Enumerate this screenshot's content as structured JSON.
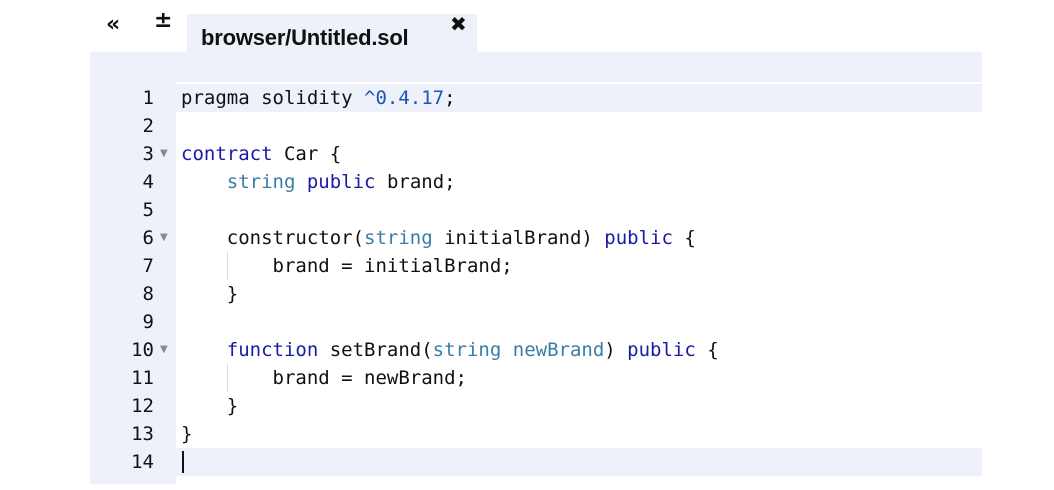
{
  "toolbar": {
    "collapse_glyph": "«",
    "plusminus_glyph": "±",
    "close_glyph": "✖"
  },
  "tab": {
    "label": "browser/Untitled.sol"
  },
  "editor": {
    "lines": [
      {
        "no": "1",
        "fold": false,
        "parts": [
          [
            "",
            "pragma solidity "
          ],
          [
            "num",
            "^0.4.17"
          ],
          [
            "",
            ";"
          ]
        ]
      },
      {
        "no": "2",
        "fold": false,
        "parts": []
      },
      {
        "no": "3",
        "fold": true,
        "parts": [
          [
            "kw",
            "contract"
          ],
          [
            "",
            " Car {"
          ]
        ]
      },
      {
        "no": "4",
        "fold": false,
        "parts": [
          [
            "",
            "    "
          ],
          [
            "ty",
            "string"
          ],
          [
            "",
            " "
          ],
          [
            "kw",
            "public"
          ],
          [
            "",
            " brand;"
          ]
        ]
      },
      {
        "no": "5",
        "fold": false,
        "parts": []
      },
      {
        "no": "6",
        "fold": true,
        "parts": [
          [
            "",
            "    constructor("
          ],
          [
            "ty",
            "string"
          ],
          [
            "",
            " initialBrand) "
          ],
          [
            "kw",
            "public"
          ],
          [
            "",
            " {"
          ]
        ]
      },
      {
        "no": "7",
        "fold": false,
        "parts": [
          [
            "",
            "        brand = initialBrand;"
          ]
        ]
      },
      {
        "no": "8",
        "fold": false,
        "parts": [
          [
            "",
            "    }"
          ]
        ]
      },
      {
        "no": "9",
        "fold": false,
        "parts": []
      },
      {
        "no": "10",
        "fold": true,
        "parts": [
          [
            "",
            "    "
          ],
          [
            "kw",
            "function"
          ],
          [
            "",
            " setBrand("
          ],
          [
            "ty",
            "string"
          ],
          [
            "",
            " "
          ],
          [
            "ty",
            "newBrand"
          ],
          [
            "",
            ") "
          ],
          [
            "kw",
            "public"
          ],
          [
            "",
            " {"
          ]
        ]
      },
      {
        "no": "11",
        "fold": false,
        "parts": [
          [
            "",
            "        brand = newBrand;"
          ]
        ]
      },
      {
        "no": "12",
        "fold": false,
        "parts": [
          [
            "",
            "    }"
          ]
        ]
      },
      {
        "no": "13",
        "fold": false,
        "parts": [
          [
            "",
            "}"
          ]
        ]
      },
      {
        "no": "14",
        "fold": false,
        "parts": []
      }
    ]
  }
}
